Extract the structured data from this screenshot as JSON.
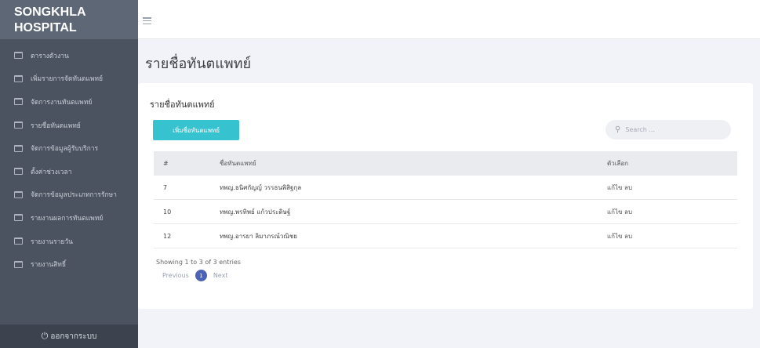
{
  "sidebar": {
    "brand_line1": "SONGKHLA",
    "brand_line2": "HOSPITAL",
    "items": [
      {
        "label": "ตารางตัวงาน"
      },
      {
        "label": "เพิ่มรายการจัดทันตแพทย์"
      },
      {
        "label": "จัดการงานทันตแพทย์"
      },
      {
        "label": "รายชื่อทันตแพทย์"
      },
      {
        "label": "จัดการข้อมูลผู้รับบริการ"
      },
      {
        "label": "ตั้งค่าช่วงเวลา"
      },
      {
        "label": "จัดการข้อมูลประเภทการรักษา"
      },
      {
        "label": "รายงานผลการทันตแพทย์"
      },
      {
        "label": "รายงานรายวัน"
      },
      {
        "label": "รายงานสิทธิ์"
      }
    ],
    "logout_icon": "power-icon",
    "logout_label": "ออกจากระบบ"
  },
  "header": {
    "menu_icon": "hamburger-icon"
  },
  "main": {
    "page_title": "รายชื่อทันตแพทย์",
    "card_title": "รายชื่อทันตแพทย์",
    "add_button": "เพิ่มชื่อทันตแพทย์",
    "search_icon": "search-icon",
    "search_placeholder": "Search ...",
    "table": {
      "columns": [
        "#",
        "ชื่อทันตแพทย์",
        "ตัวเลือก"
      ],
      "rows": [
        {
          "num": "7",
          "name": "ทพญ.ธนิศกัญญ์ วรรธนพิสิฐกุล",
          "edit": "แก้ไข",
          "delete": "ลบ"
        },
        {
          "num": "10",
          "name": "ทพญ.พรทิพย์ แก้วประดิษฐ์",
          "edit": "แก้ไข",
          "delete": "ลบ"
        },
        {
          "num": "12",
          "name": "ทพญ.อารยา ลิมาภรณ์วณิชย",
          "edit": "แก้ไข",
          "delete": "ลบ"
        }
      ]
    },
    "entries_info": "Showing 1 to 3 of 3 entries",
    "pager": {
      "prev": "Previous",
      "current": "1",
      "next": "Next"
    }
  },
  "colors": {
    "sidebar_bg": "#4b5361",
    "brand_bg": "#5e6776",
    "accent_button": "#36c2cf",
    "pager_active": "#4c62b7"
  }
}
